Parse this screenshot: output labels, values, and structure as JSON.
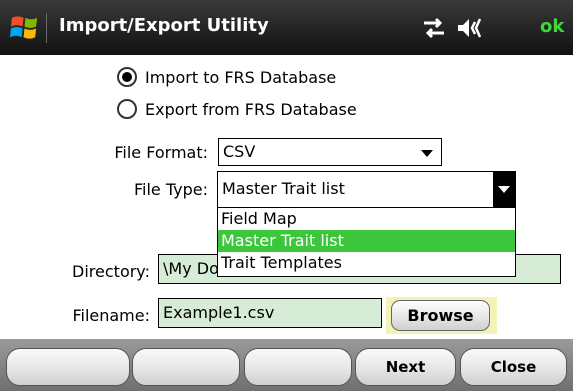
{
  "title_bar": {
    "title": "Import/Export Utility",
    "ok_label": "ok",
    "icons": [
      "windows-start-icon",
      "connectivity-icon",
      "speaker-icon"
    ]
  },
  "mode": {
    "options": [
      {
        "label": "Import to FRS Database",
        "checked": true
      },
      {
        "label": "Export from FRS Database",
        "checked": false
      }
    ]
  },
  "file_format": {
    "label": "File Format:",
    "value": "CSV"
  },
  "file_type": {
    "label": "File Type:",
    "value": "Master Trait list",
    "options": [
      "Field Map",
      "Master Trait list",
      "Trait Templates"
    ],
    "selected_index": 1,
    "expanded": true
  },
  "directory": {
    "label": "Directory:",
    "value": "\\My Documents"
  },
  "filename": {
    "label": "Filename:",
    "value": "Example1.csv"
  },
  "browse_label": "Browse",
  "softkeys": [
    "",
    "",
    "",
    "Next",
    "Close"
  ],
  "colors": {
    "title_bar": "#1a1a1a",
    "ok_text": "#3fd83a",
    "field_bg": "#d6ecd6",
    "selection": "#3cc63c",
    "browse_highlight": "#f4f2b6"
  }
}
